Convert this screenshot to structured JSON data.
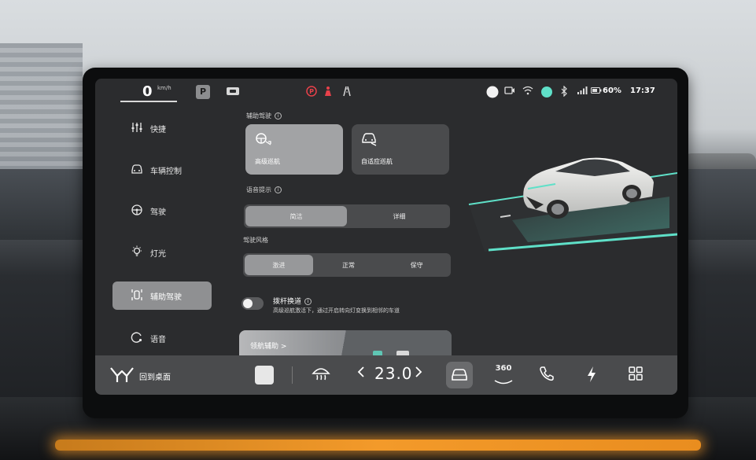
{
  "status_bar": {
    "speed": "0",
    "speed_unit": "km/h",
    "gear": "P",
    "battery": "60%",
    "time": "17:37"
  },
  "sidebar": {
    "items": [
      {
        "label": "快捷",
        "icon": "sliders-icon"
      },
      {
        "label": "车辆控制",
        "icon": "car-front-icon"
      },
      {
        "label": "驾驶",
        "icon": "steering-wheel-icon"
      },
      {
        "label": "灯光",
        "icon": "light-bulb-icon"
      },
      {
        "label": "辅助驾驶",
        "icon": "assist-driving-icon",
        "active": true
      },
      {
        "label": "语音",
        "icon": "voice-icon"
      }
    ]
  },
  "main": {
    "assist_title": "辅助驾驶",
    "modes": [
      {
        "label": "高级巡航",
        "selected": true
      },
      {
        "label": "自适应巡航",
        "selected": false
      }
    ],
    "voice_title": "语音提示",
    "voice_options": [
      {
        "label": "简洁",
        "selected": true
      },
      {
        "label": "详细",
        "selected": false
      }
    ],
    "style_title": "驾驶风格",
    "style_options": [
      {
        "label": "激进",
        "selected": true
      },
      {
        "label": "正常",
        "selected": false
      },
      {
        "label": "保守",
        "selected": false
      }
    ],
    "lane_change": {
      "title": "拨杆换道",
      "description": "高级巡航激活下，通过开启转向灯变换到相邻的车道",
      "enabled": false
    },
    "nav_assist_label": "领航辅助 >"
  },
  "dock": {
    "home_label": "回到桌面",
    "temperature": "23.0",
    "items": [
      "app-thumbnail-icon",
      "defrost-icon",
      "car-settings-icon",
      "camera-360-icon",
      "phone-icon",
      "charging-icon",
      "apps-grid-icon"
    ],
    "camera_label": "360"
  },
  "colors": {
    "screen_bg": "#2b2c2e",
    "selected": "#a2a3a5",
    "accent_teal": "#5fe0c8",
    "warning_red": "#e8414a",
    "ambient_orange": "#f39a2a"
  }
}
